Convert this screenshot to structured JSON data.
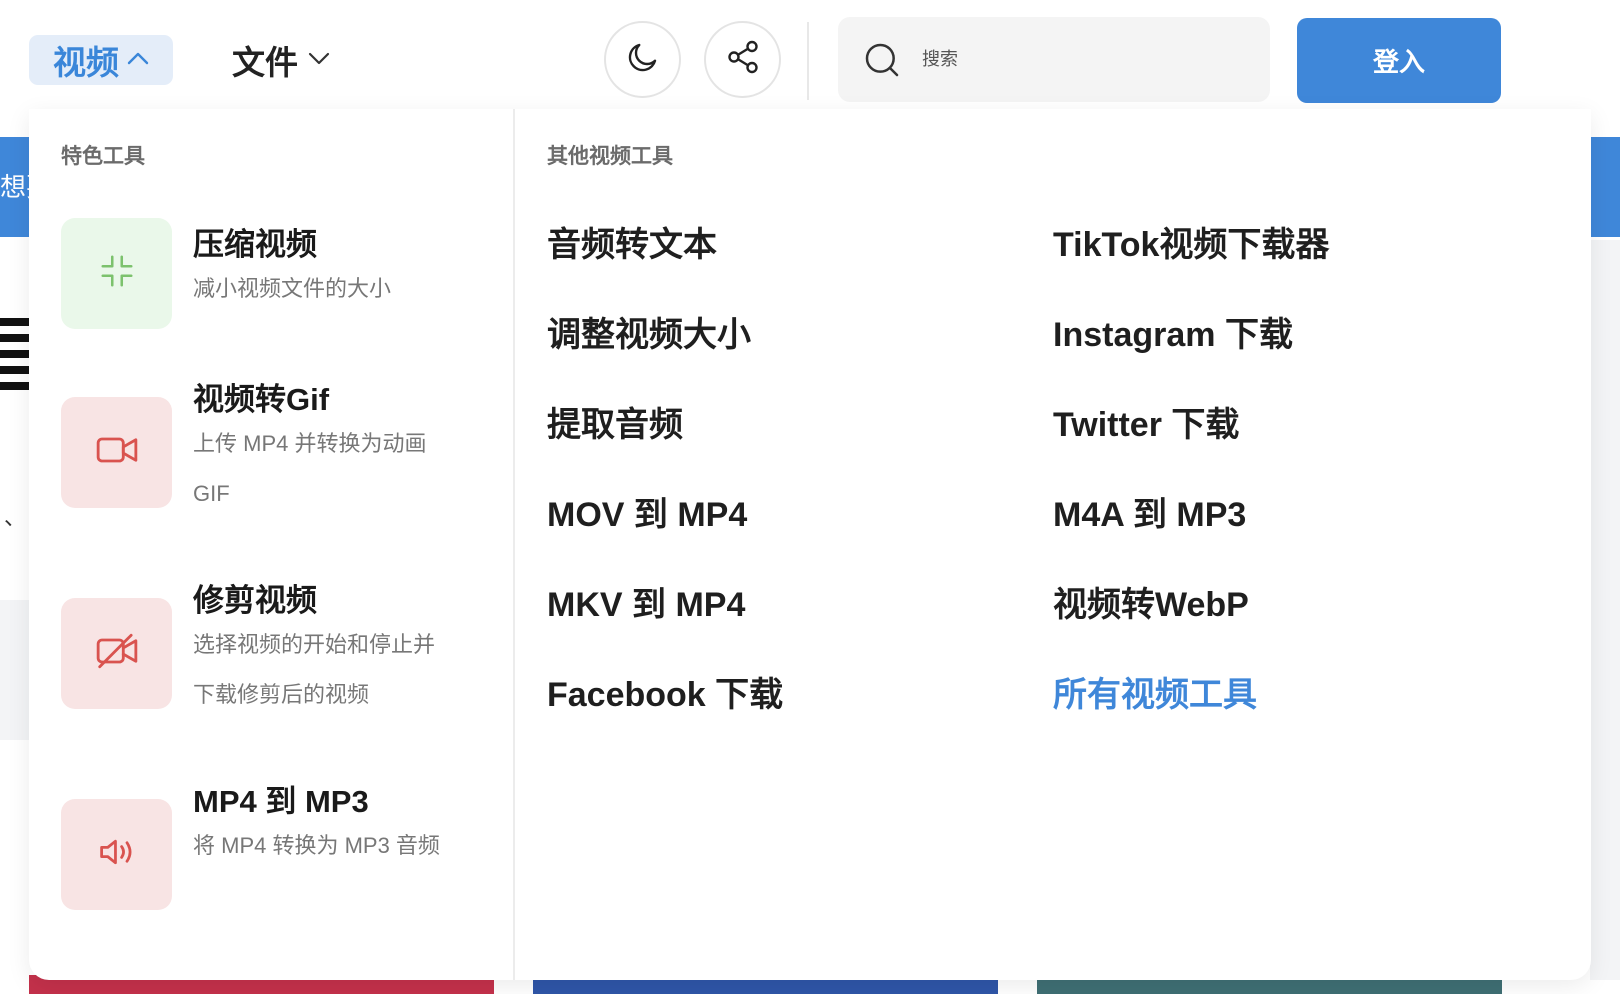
{
  "header": {
    "nav_video_label": "视频",
    "nav_file_label": "文件",
    "search_placeholder": "搜索",
    "login_label": "登入"
  },
  "background": {
    "left_banner_fragment": "想要",
    "left_comma": "、"
  },
  "dropdown": {
    "featured_title": "特色工具",
    "other_title": "其他视频工具",
    "featured": [
      {
        "title": "压缩视频",
        "desc": "减小视频文件的大小",
        "icon": "compress-icon",
        "tile_color": "#eaf8ea"
      },
      {
        "title": "视频转Gif",
        "desc": "上传 MP4 并转换为动画 GIF",
        "icon": "video-camera-icon",
        "tile_color": "#f8e4e4"
      },
      {
        "title": "修剪视频",
        "desc": "选择视频的开始和停止并下载修剪后的视频",
        "icon": "video-off-icon",
        "tile_color": "#f8e4e4"
      },
      {
        "title": "MP4 到 MP3",
        "desc": "将 MP4 转换为 MP3 音频",
        "icon": "speaker-icon",
        "tile_color": "#f8e4e4"
      }
    ],
    "tools_col1": [
      "音频转文本",
      "调整视频大小",
      "提取音频",
      "MOV 到 MP4",
      "MKV 到 MP4",
      "Facebook 下载"
    ],
    "tools_col2": [
      "TikTok视频下载器",
      "Instagram 下载",
      "Twitter 下载",
      "M4A 到 MP3",
      "视频转WebP",
      "所有视频工具"
    ]
  },
  "colors": {
    "accent": "#3f87d9",
    "compress_icon": "#7cc26d",
    "video_icon": "#d9534f"
  }
}
